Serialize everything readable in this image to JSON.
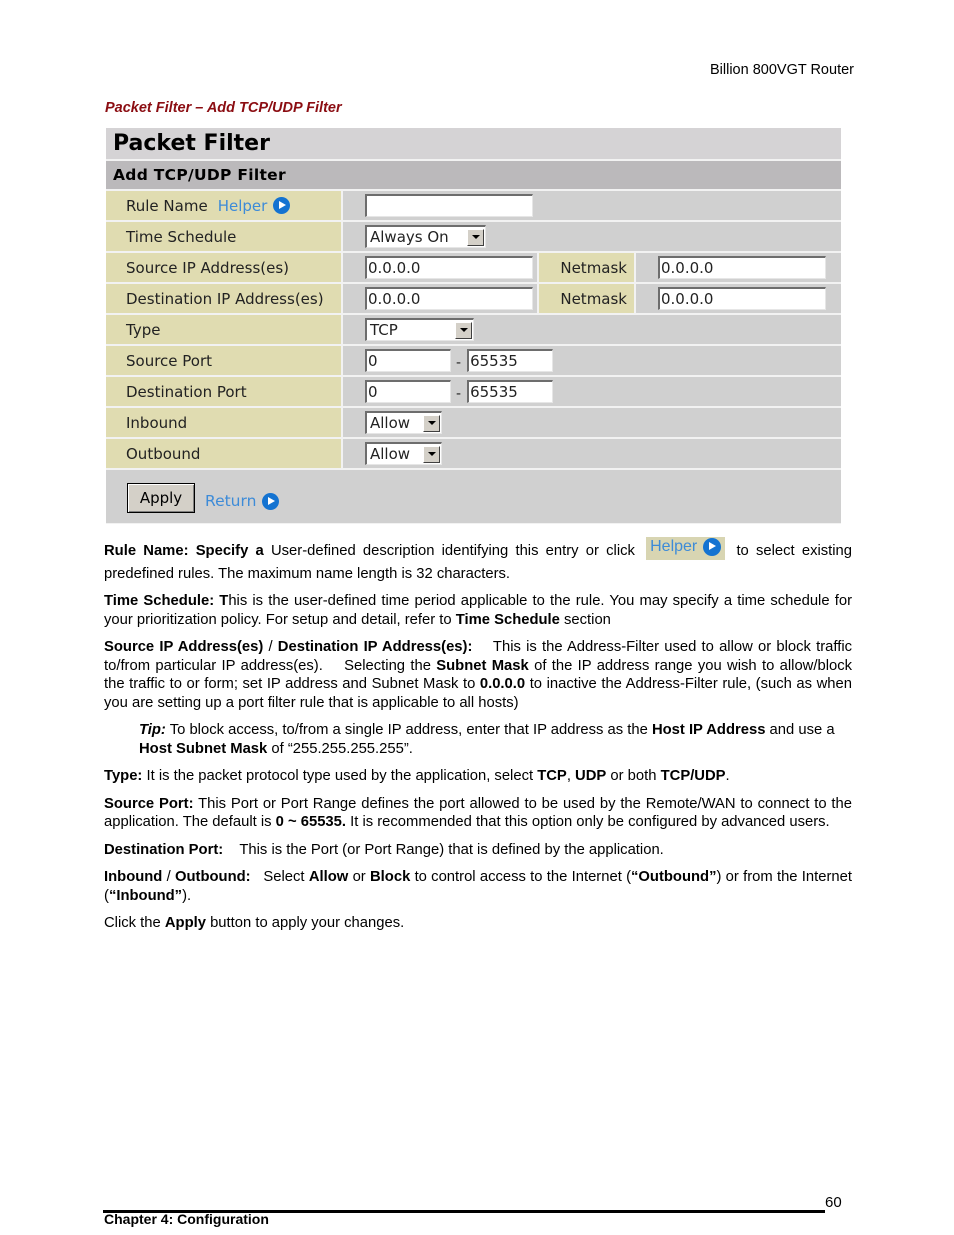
{
  "page_header": "Billion 800VGT Router",
  "section_title": "Packet Filter – Add TCP/UDP Filter",
  "panel": {
    "title": "Packet Filter",
    "subtitle": "Add TCP/UDP Filter",
    "helper_link": "Helper",
    "rows": {
      "rule_name": {
        "label": "Rule Name",
        "value": ""
      },
      "time_schedule": {
        "label": "Time Schedule",
        "value": "Always On"
      },
      "source_ip": {
        "label": "Source IP Address(es)",
        "value": "0.0.0.0",
        "netmask_label": "Netmask",
        "netmask_value": "0.0.0.0"
      },
      "destination_ip": {
        "label": "Destination IP Address(es)",
        "value": "0.0.0.0",
        "netmask_label": "Netmask",
        "netmask_value": "0.0.0.0"
      },
      "type": {
        "label": "Type",
        "value": "TCP"
      },
      "source_port": {
        "label": "Source Port",
        "from": "0",
        "to": "65535",
        "separator": "-"
      },
      "destination_port": {
        "label": "Destination Port",
        "from": "0",
        "to": "65535",
        "separator": "-"
      },
      "inbound": {
        "label": "Inbound",
        "value": "Allow"
      },
      "outbound": {
        "label": "Outbound",
        "value": "Allow"
      }
    },
    "apply_button": "Apply",
    "return_link": "Return"
  },
  "body": {
    "rule_name": {
      "b1": "Rule Name: Specify a",
      "t1": " User-defined description identifying this entry or click ",
      "helper": "Helper",
      "t2": " to select existing predefined rules. The maximum name length is 32 characters."
    },
    "time_schedule": {
      "b1": "Time Schedule: T",
      "t1": "his is the user-defined time period applicable to the rule. You may specify a time schedule for your prioritization policy. For setup and detail, refer to ",
      "b2": "Time Schedule",
      "t2": " section"
    },
    "ip_address": {
      "b1": "Source IP Address(es)",
      "t1": " / ",
      "b2": "Destination IP Address(es):",
      "t2": "    This is the Address-Filter used to allow or block traffic to/from particular IP address(es).    Selecting the ",
      "b3": "Subnet Mask",
      "t3": " of the IP address range you wish to allow/block the traffic to or form; set IP address and Subnet Mask to ",
      "b4": "0.0.0.0",
      "t4": " to inactive the Address-Filter rule, (such as when you are setting up a port filter rule that is applicable to all hosts)"
    },
    "tip": {
      "b1": "Tip:",
      "t1": " To block access, to/from a single IP address, enter that IP address as the ",
      "b2": "Host IP Address",
      "t2": " and use a ",
      "b3": "Host Subnet Mask",
      "t3": " of “255.255.255.255”."
    },
    "type": {
      "b1": "Type:",
      "t1": " It is the packet protocol type used by the application, select ",
      "b2": "TCP",
      "t2": ", ",
      "b3": "UDP",
      "t3": " or both ",
      "b4": "TCP/UDP",
      "t4": "."
    },
    "source_port": {
      "b1": "Source Port:",
      "t1": " This Port or Port Range defines the port allowed to be used by the Remote/WAN to connect to the application. The default is ",
      "b2": "0 ~ 65535.",
      "t2": " It is recommended that this option only be configured by advanced users."
    },
    "destination_port": {
      "b1": "Destination Port:",
      "t1": "    This is the Port (or Port Range) that is defined by the application."
    },
    "inbound_outbound": {
      "b1": "Inbound",
      "t1": " / ",
      "b2": "Outbound:",
      "t2": "   Select ",
      "b3": "Allow",
      "t3": " or ",
      "b4": "Block",
      "t4": " to control access to the Internet (",
      "b5": "“Outbound”",
      "t5": ") or from the Internet (",
      "b6": "“Inbound”",
      "t6": ")."
    },
    "apply": {
      "t1": "Click the ",
      "b1": "Apply",
      "t2": " button to apply your changes."
    }
  },
  "footer": {
    "page_number": "60",
    "chapter": "Chapter 4: Configuration"
  }
}
